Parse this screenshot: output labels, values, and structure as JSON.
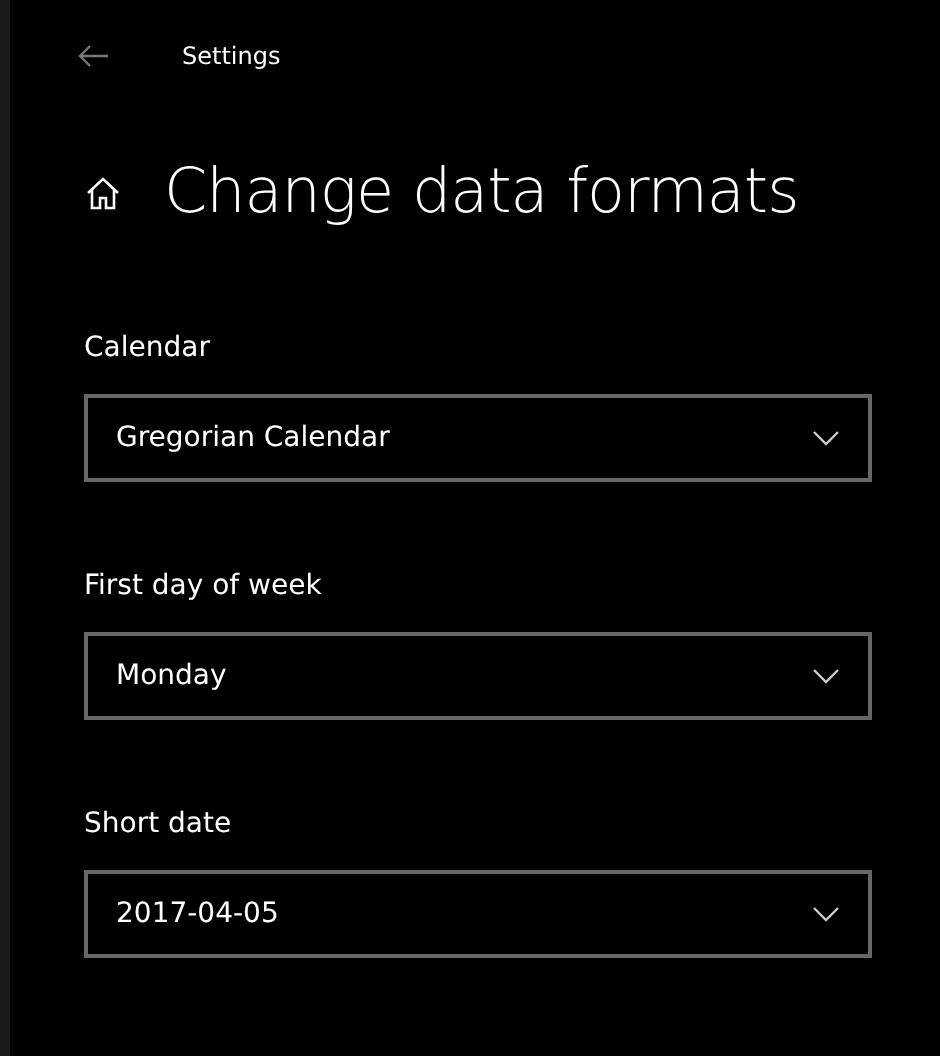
{
  "window": {
    "title": "Settings"
  },
  "page": {
    "title": "Change data formats"
  },
  "settings": [
    {
      "label": "Calendar",
      "value": "Gregorian Calendar"
    },
    {
      "label": "First day of week",
      "value": "Monday"
    },
    {
      "label": "Short date",
      "value": "2017-04-05"
    }
  ]
}
